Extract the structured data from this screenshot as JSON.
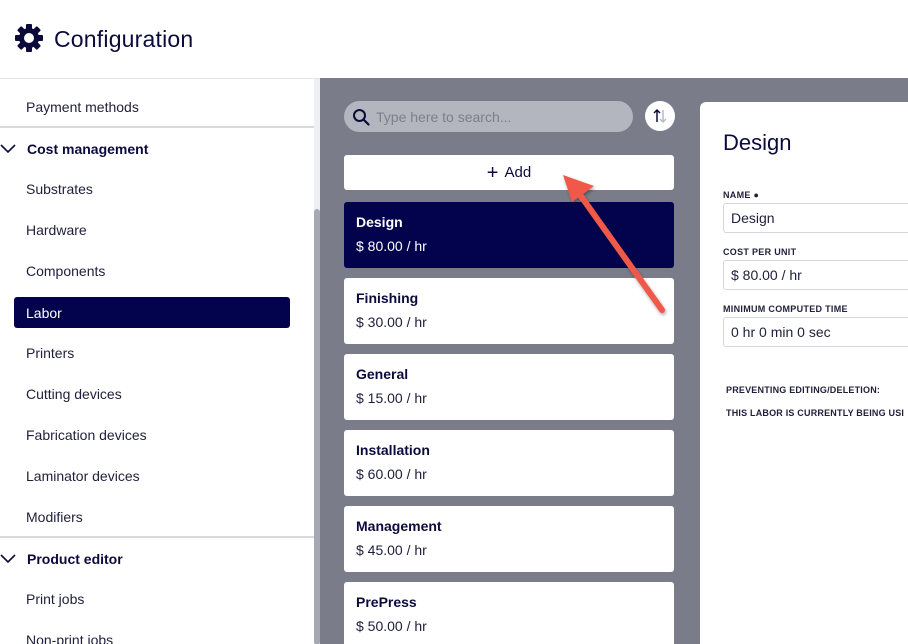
{
  "header": {
    "title": "Configuration",
    "icon": "gear-icon"
  },
  "sidebar": {
    "payment_methods": "Payment methods",
    "cost_management": "Cost management",
    "substrates": "Substrates",
    "hardware": "Hardware",
    "components": "Components",
    "labor": "Labor",
    "printers": "Printers",
    "cutting_devices": "Cutting devices",
    "fabrication_devices": "Fabrication devices",
    "laminator_devices": "Laminator devices",
    "modifiers": "Modifiers",
    "product_editor": "Product editor",
    "print_jobs": "Print jobs",
    "non_print_jobs": "Non-print jobs"
  },
  "list": {
    "search_placeholder": "Type here to search...",
    "add_label": "Add",
    "items": [
      {
        "name": "Design",
        "price": "$ 80.00 / hr"
      },
      {
        "name": "Finishing",
        "price": "$ 30.00 / hr"
      },
      {
        "name": "General",
        "price": "$ 15.00 / hr"
      },
      {
        "name": "Installation",
        "price": "$ 60.00 / hr"
      },
      {
        "name": "Management",
        "price": "$ 45.00 / hr"
      },
      {
        "name": "PrePress",
        "price": "$ 50.00 / hr"
      }
    ]
  },
  "detail": {
    "title": "Design",
    "name_label": "NAME ●",
    "name_value": "Design",
    "cost_label": "COST PER UNIT",
    "cost_value": "$ 80.00 / hr",
    "time_label": "MINIMUM COMPUTED TIME",
    "time_value": "0 hr 0 min 0 sec",
    "preventing_label": "PREVENTING EDITING/DELETION:",
    "in_use_note": "THIS LABOR IS CURRENTLY BEING USI"
  },
  "colors": {
    "accent": "#03034d",
    "panel": "#7a7d89",
    "arrow": "#f0584a"
  }
}
